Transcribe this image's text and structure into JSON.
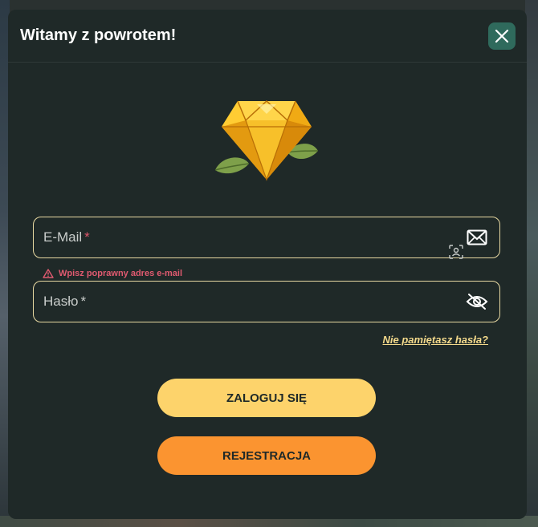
{
  "modal": {
    "title": "Witamy z powrotem!",
    "close_icon": "close-icon"
  },
  "logo": {
    "icon": "diamond-logo"
  },
  "email": {
    "label": "E-Mail",
    "required_mark": "*",
    "icon": "envelope-icon",
    "error": "Wpisz poprawny adres e-mail"
  },
  "password": {
    "label": "Hasło",
    "required_mark": "*",
    "icon": "eye-off-icon"
  },
  "forgot_link": "Nie pamiętasz hasła?",
  "buttons": {
    "login": "ZALOGUJ SIĘ",
    "register": "REJESTRACJA"
  },
  "colors": {
    "background": "#1f2928",
    "accent_yellow": "#fdd36b",
    "accent_orange": "#fb9430",
    "error": "#e05a70",
    "close_bg": "#2f6a5c"
  }
}
